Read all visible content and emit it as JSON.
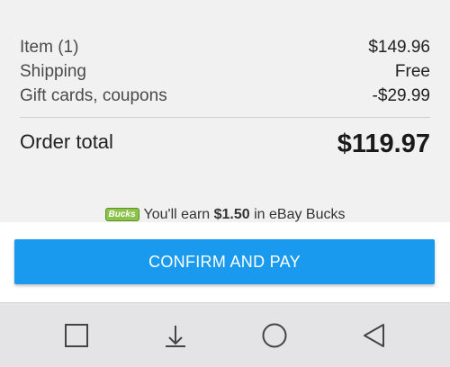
{
  "summary": {
    "items": [
      {
        "label": "Item (1)",
        "value": "$149.96"
      },
      {
        "label": "Shipping",
        "value": "Free"
      },
      {
        "label": "Gift cards, coupons",
        "value": "-$29.99"
      }
    ],
    "total_label": "Order total",
    "total_value": "$119.97"
  },
  "bucks": {
    "badge": "Bucks",
    "prefix": "You'll earn ",
    "amount": "$1.50",
    "suffix": " in eBay Bucks"
  },
  "confirm_button": {
    "label": "CONFIRM AND PAY"
  },
  "navbar": {
    "icons": [
      "square-icon",
      "download-icon",
      "circle-home-icon",
      "triangle-back-icon"
    ]
  },
  "colors": {
    "accent": "#1a9aef",
    "bucks_badge": "#8bc34a",
    "background": "#f1f1f1",
    "navbar": "#e4e4e6"
  }
}
